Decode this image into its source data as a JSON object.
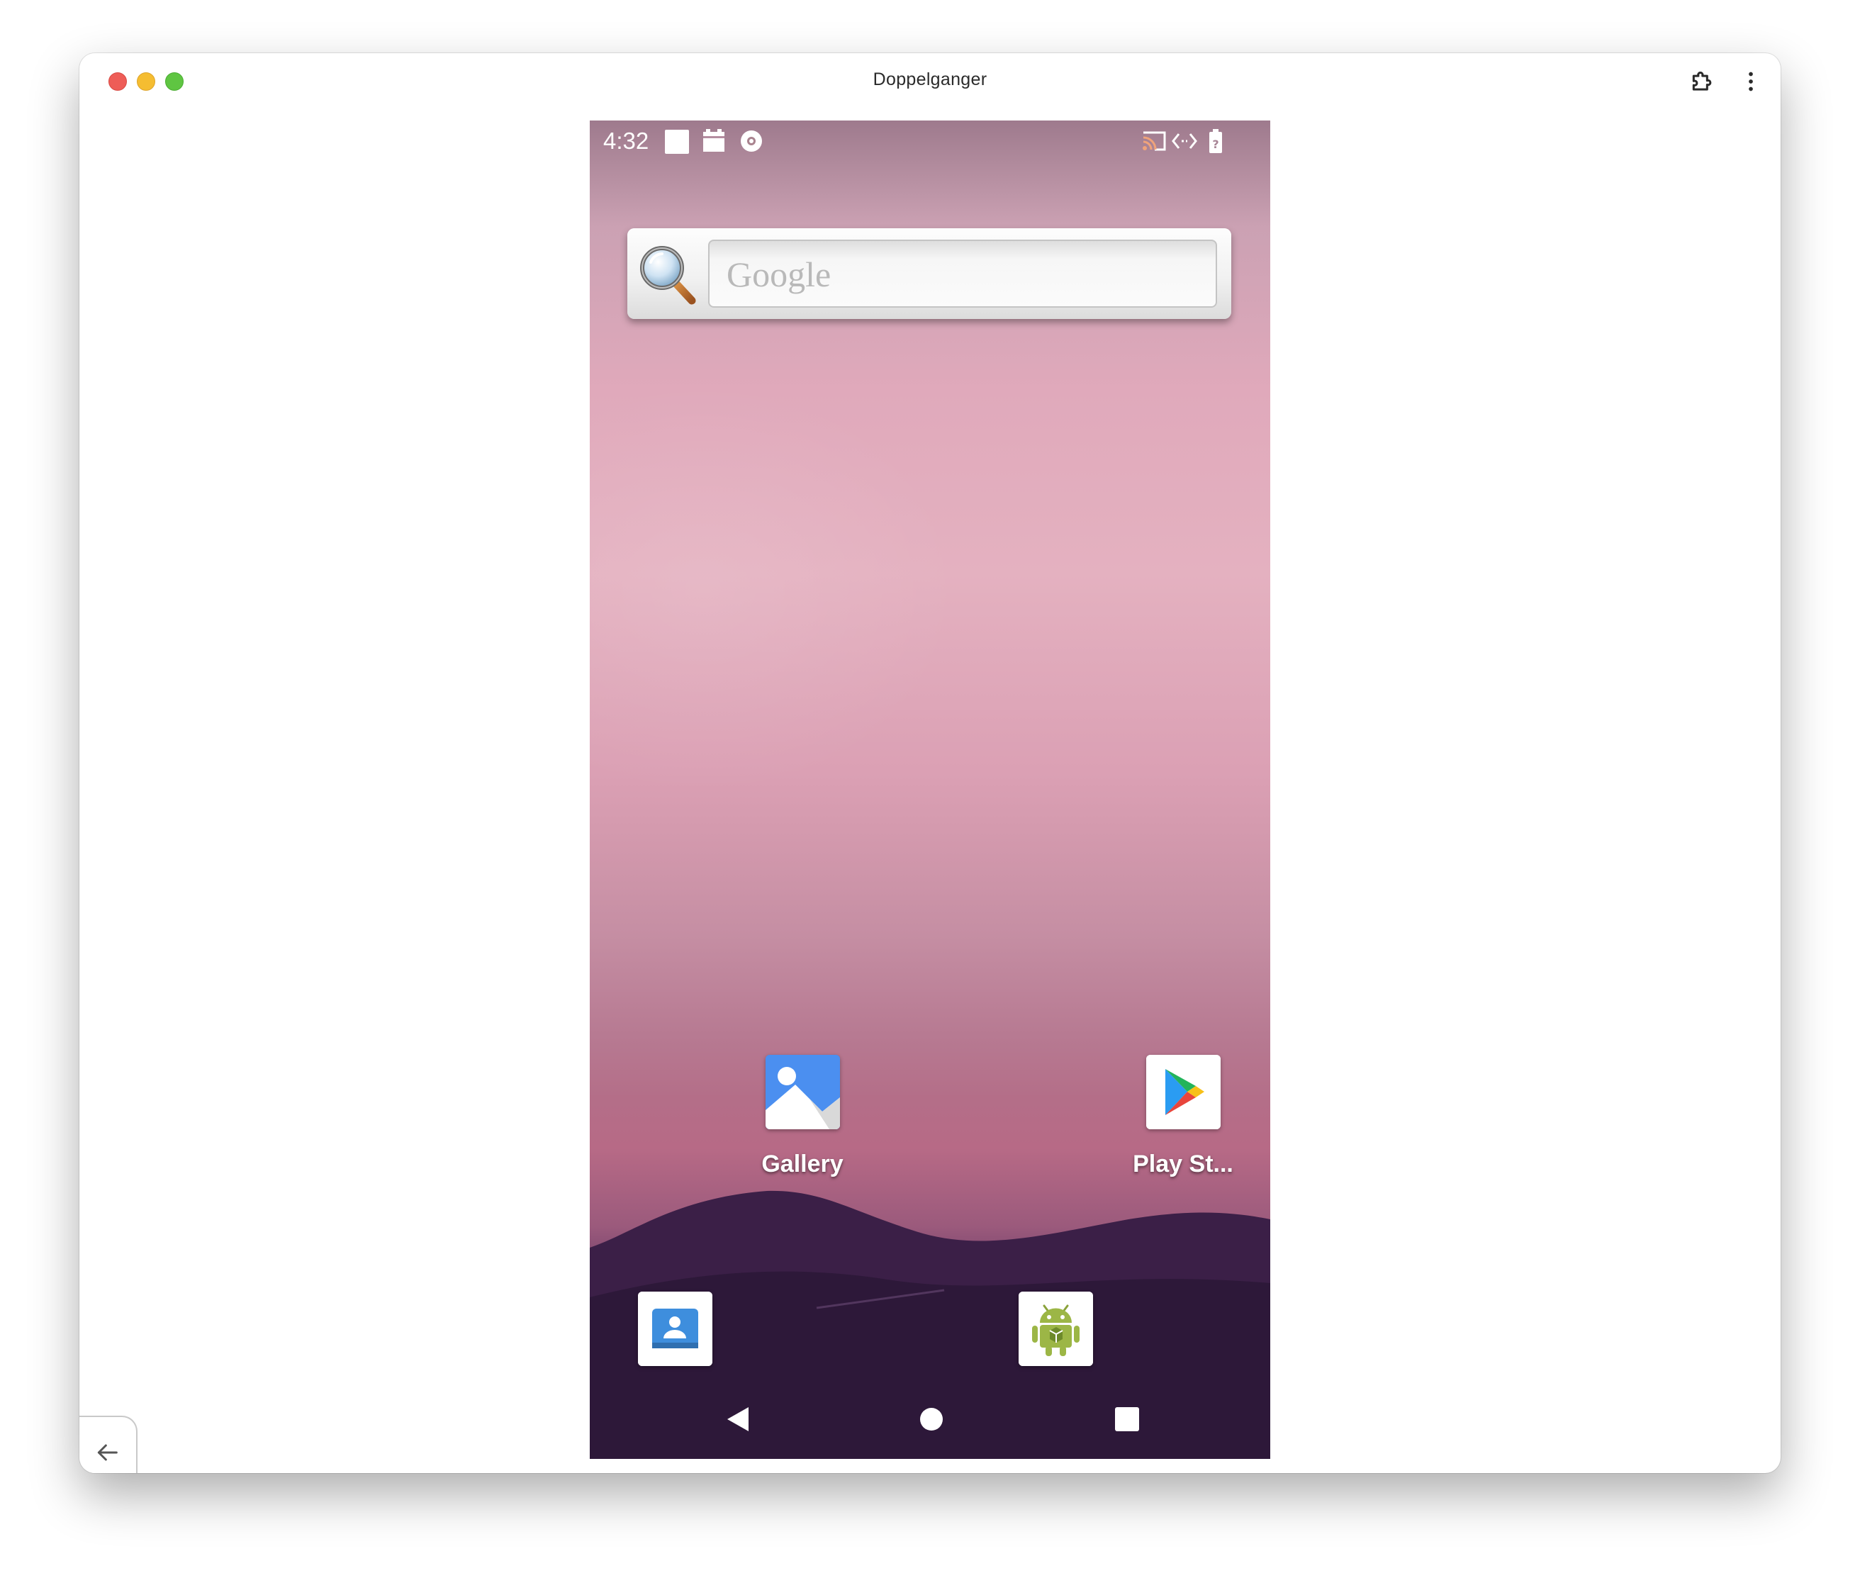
{
  "window": {
    "title": "Doppelganger",
    "controls": [
      "close",
      "minimize",
      "maximize"
    ],
    "toolbar_icons": [
      "extensions-icon",
      "more-vert-icon"
    ],
    "back_icon": "arrow-left-icon"
  },
  "status_bar": {
    "time": "4:32",
    "left_icons": [
      "notification-square-icon",
      "sim-card-icon",
      "record-icon"
    ],
    "right_icons": [
      "cast-icon",
      "code-brackets-icon",
      "battery-unknown-icon"
    ]
  },
  "search_widget": {
    "placeholder": "Google",
    "icon": "magnifier-icon"
  },
  "apps": [
    {
      "label": "Gallery",
      "icon": "gallery-icon"
    },
    {
      "label": "Play St...",
      "icon": "play-store-icon"
    }
  ],
  "dock": [
    {
      "label": "",
      "icon": "contacts-icon"
    },
    {
      "label": "",
      "icon": "android-app-icon"
    }
  ],
  "nav_bar": {
    "buttons": [
      "back-triangle-icon",
      "home-circle-icon",
      "recents-square-icon"
    ]
  },
  "colors": {
    "wallpaper_top": "#cba1b3",
    "wallpaper_mid": "#e4b1c0",
    "wallpaper_bottom": "#22132c",
    "close": "#ee5d57",
    "minimize": "#f5bd31",
    "maximize": "#5fc542"
  }
}
